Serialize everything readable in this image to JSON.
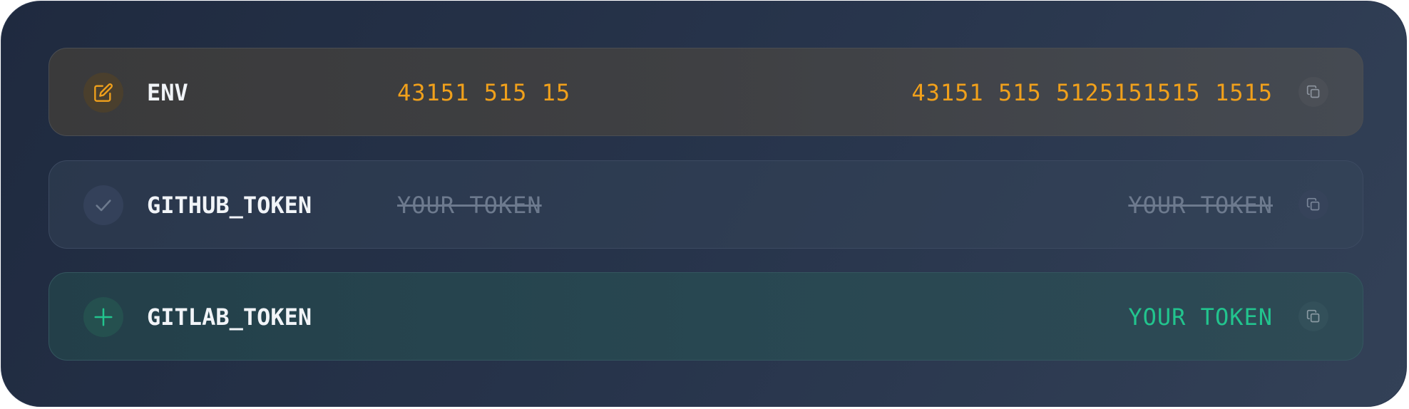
{
  "colors": {
    "modified_accent": "#f0a01b",
    "added_accent": "#22c48e",
    "unchanged_text": "#6d7a8e",
    "key_text": "#f1f4f8"
  },
  "rows": [
    {
      "status": "modified",
      "status_icon": "pencil-edit-icon",
      "key": "ENV",
      "old_value": "43151 515 15",
      "new_value": "43151 515 5125151515 1515",
      "copy_icon": "copy-icon"
    },
    {
      "status": "unchanged",
      "status_icon": "check-icon",
      "key": "GITHUB_TOKEN",
      "old_value": "YOUR TOKEN",
      "new_value": "YOUR TOKEN",
      "copy_icon": "copy-icon"
    },
    {
      "status": "added",
      "status_icon": "plus-icon",
      "key": "GITLAB_TOKEN",
      "old_value": "",
      "new_value": "YOUR TOKEN",
      "copy_icon": "copy-icon"
    }
  ]
}
